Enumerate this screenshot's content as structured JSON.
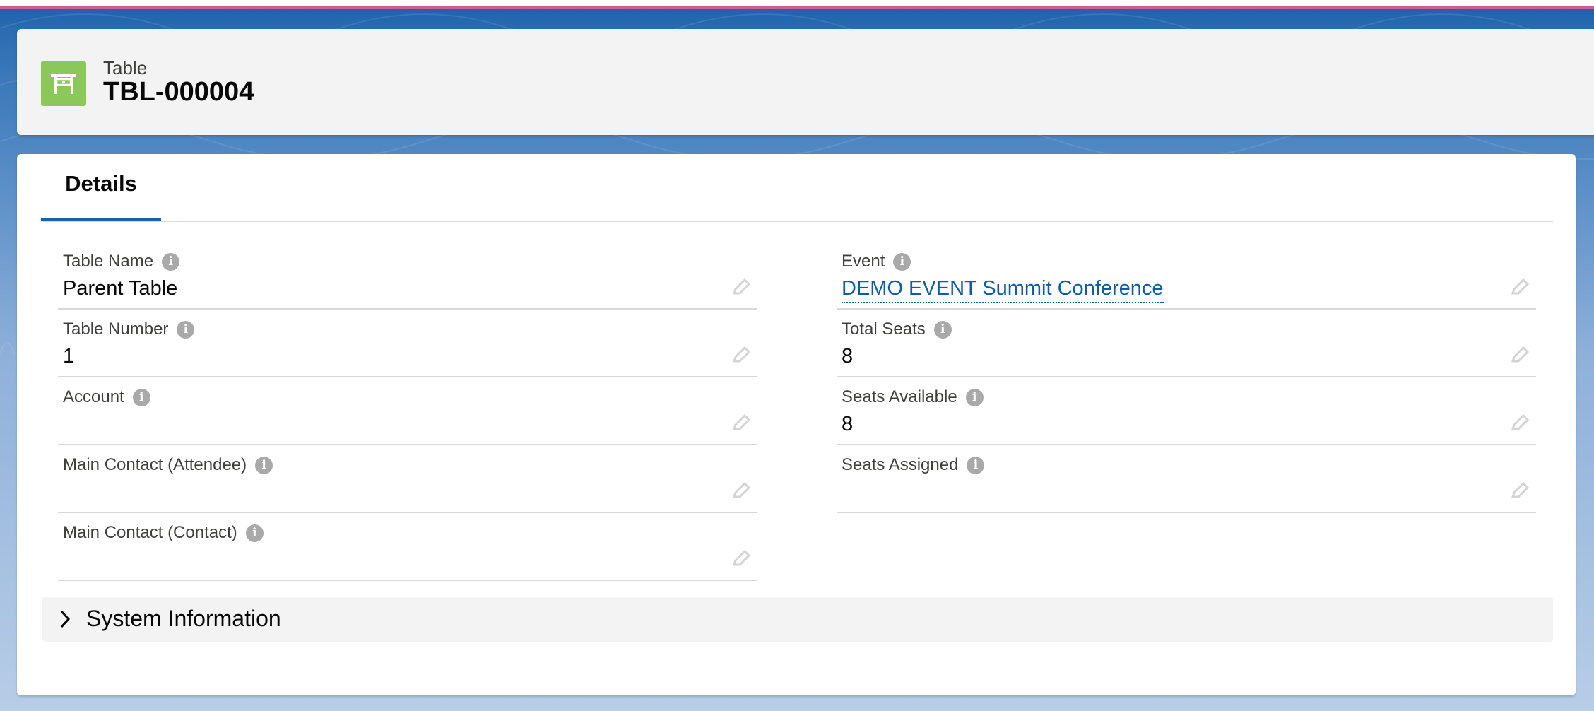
{
  "header": {
    "object_type": "Table",
    "record_name": "TBL-000004",
    "icon": "table-icon"
  },
  "tabs": [
    {
      "label": "Details",
      "active": true
    }
  ],
  "fields": {
    "table_name": {
      "label": "Table Name",
      "value": "Parent Table"
    },
    "table_number": {
      "label": "Table Number",
      "value": "1"
    },
    "account": {
      "label": "Account",
      "value": ""
    },
    "main_contact_attendee": {
      "label": "Main Contact (Attendee)",
      "value": ""
    },
    "main_contact_contact": {
      "label": "Main Contact (Contact)",
      "value": ""
    },
    "event": {
      "label": "Event",
      "value": "DEMO EVENT Summit Conference",
      "is_link": true
    },
    "total_seats": {
      "label": "Total Seats",
      "value": "8"
    },
    "seats_available": {
      "label": "Seats Available",
      "value": "8"
    },
    "seats_assigned": {
      "label": "Seats Assigned",
      "value": ""
    }
  },
  "sections": {
    "system_information": {
      "label": "System Information",
      "expanded": false
    }
  },
  "colors": {
    "accent": "#1b5fb0",
    "link": "#0b5cab",
    "object_icon": "#8cc859",
    "top_stripe": "#c8609e"
  }
}
